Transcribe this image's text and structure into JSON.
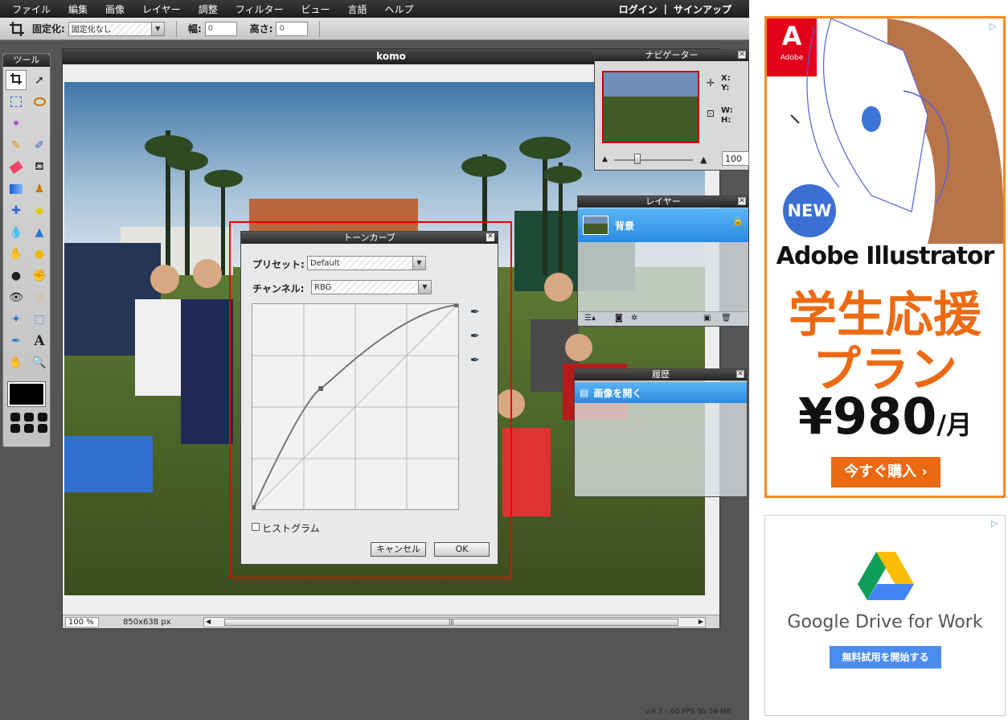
{
  "menu": {
    "items": [
      "ファイル",
      "編集",
      "画像",
      "レイヤー",
      "調整",
      "フィルター",
      "ビュー",
      "言語",
      "ヘルプ"
    ],
    "login": "ログイン",
    "sep": "|",
    "signup": "サインアップ"
  },
  "options": {
    "fix_label": "固定化:",
    "fix_value": "固定化なし",
    "width_label": "幅:",
    "width_value": "0",
    "height_label": "高さ:",
    "height_value": "0"
  },
  "tools": {
    "title": "ツール"
  },
  "document": {
    "title": "komo",
    "zoom": "100 %",
    "size": "850x638 px"
  },
  "navigator": {
    "title": "ナビゲーター",
    "x": "X:",
    "y": "Y:",
    "w": "W:",
    "h": "H:",
    "zoom": "100"
  },
  "layers": {
    "title": "レイヤー",
    "layer_name": "背景"
  },
  "history": {
    "title": "履歴",
    "item": "画像を開く"
  },
  "curves": {
    "title": "トーンカーブ",
    "preset_label": "プリセット:",
    "preset_value": "Default",
    "channel_label": "チャンネル:",
    "channel_value": "RBG",
    "histogram_label": "ヒストグラム",
    "cancel": "キャンセル",
    "ok": "OK"
  },
  "ad1": {
    "brand": "Adobe",
    "badge": "NEW",
    "product": "Adobe Illustrator",
    "headline1": "学生応援",
    "headline2": "プラン",
    "price": "¥980",
    "per": "/月",
    "cta": "今すぐ購入",
    "cta_arrow": "›"
  },
  "ad2": {
    "product": "Google Drive for Work",
    "cta": "無料試用を開始する"
  },
  "status": {
    "version": "v.6.7 - 60 FPS 30.59 MB"
  },
  "colors": {
    "accent": "#2a8ae0",
    "orange": "#f08a24",
    "red_box": "#e00000"
  }
}
